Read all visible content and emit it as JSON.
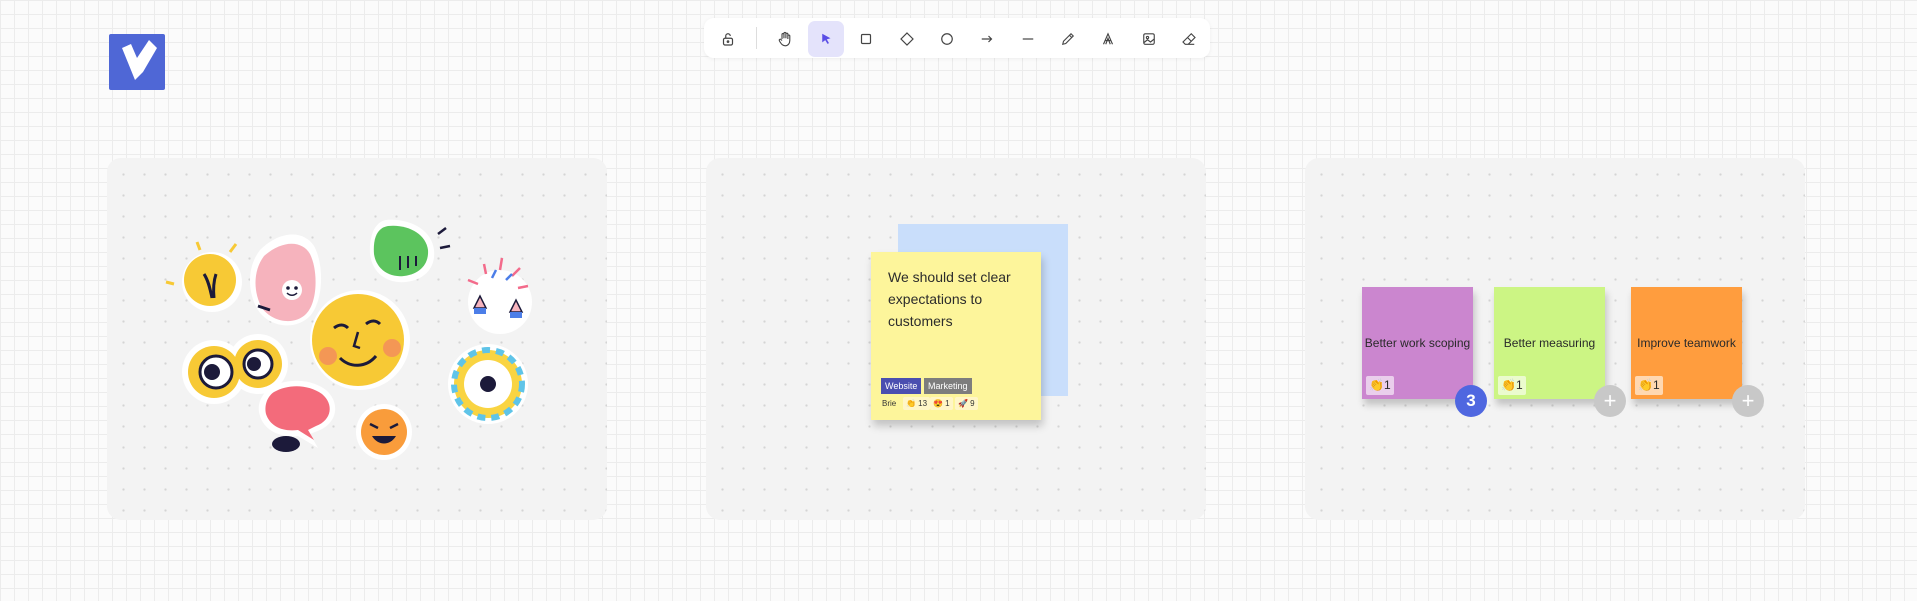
{
  "toolbar": {
    "tools": [
      {
        "name": "lock",
        "icon": "lock-open-icon",
        "active": false
      },
      {
        "name": "hand",
        "icon": "hand-icon",
        "active": false
      },
      {
        "name": "select",
        "icon": "pointer-icon",
        "active": true
      },
      {
        "name": "rectangle",
        "icon": "square-icon",
        "active": false
      },
      {
        "name": "diamond",
        "icon": "diamond-icon",
        "active": false
      },
      {
        "name": "ellipse",
        "icon": "circle-icon",
        "active": false
      },
      {
        "name": "arrow",
        "icon": "arrow-right-icon",
        "active": false
      },
      {
        "name": "line",
        "icon": "line-icon",
        "active": false
      },
      {
        "name": "draw",
        "icon": "pencil-icon",
        "active": false
      },
      {
        "name": "text",
        "icon": "text-icon",
        "active": false
      },
      {
        "name": "image",
        "icon": "image-icon",
        "active": false
      },
      {
        "name": "eraser",
        "icon": "eraser-icon",
        "active": false
      }
    ],
    "active_color": "#7b6ff0"
  },
  "logo": {
    "color": "#4f67d6",
    "icon": "logo-icon"
  },
  "panel1": {
    "stickers": [
      "lightbulb-sticker",
      "ok-hand-sticker",
      "pointing-hand-sticker",
      "eyes-sticker",
      "smiley-sticker",
      "confetti-hands-sticker",
      "help-bubble-sticker",
      "wow-sticker",
      "laughing-face-sticker"
    ]
  },
  "panel2": {
    "note_text": "We should set clear expectations to customers",
    "tags": [
      "Website",
      "Marketing"
    ],
    "author": "Brie",
    "reactions": [
      "👏 13",
      "😍 1",
      "🚀 9"
    ]
  },
  "panel3": {
    "notes": [
      {
        "text": "Better work scoping",
        "votes": "👏1",
        "color": "#cb86cf"
      },
      {
        "text": "Better measuring",
        "votes": "👏1",
        "color": "#ccf584"
      },
      {
        "text": "Improve teamwork",
        "votes": "👏1",
        "color": "#ff9d3e"
      }
    ],
    "vote_count": "3",
    "add_symbol": "+"
  }
}
